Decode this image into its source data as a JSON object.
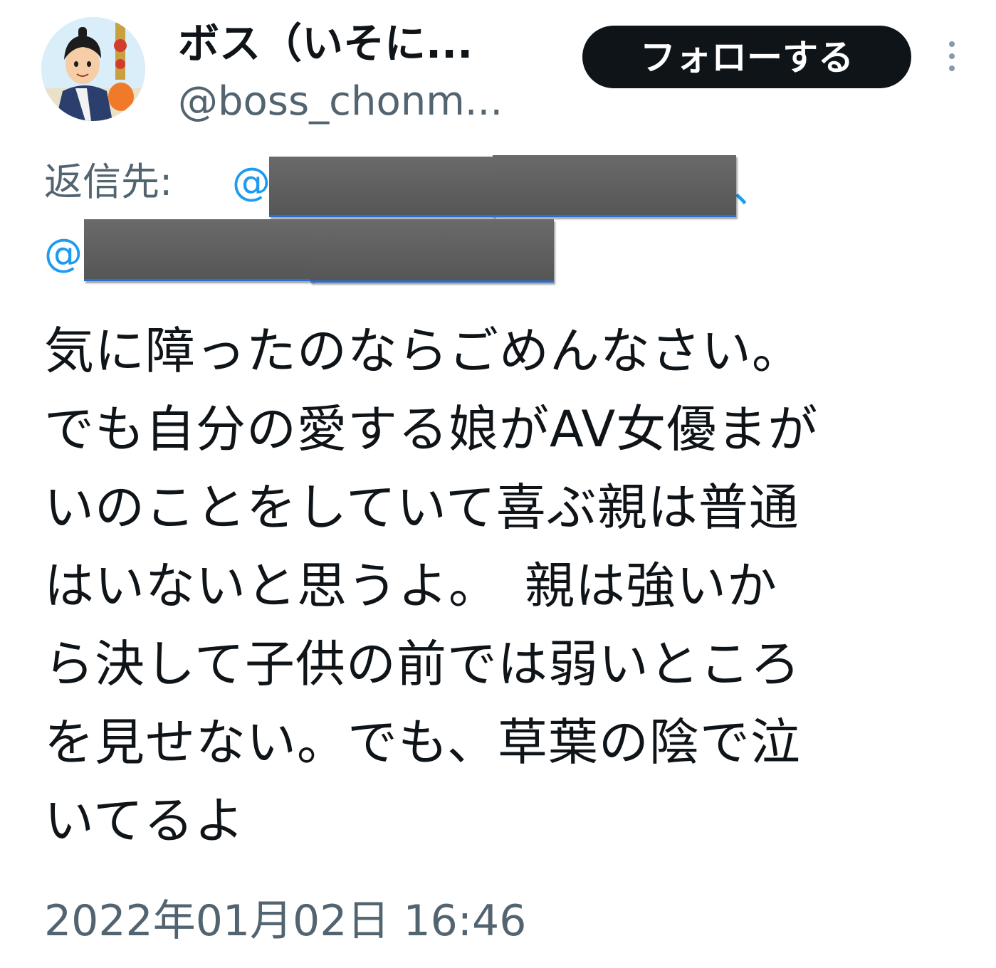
{
  "tweet": {
    "display_name": "ボス（いそに...",
    "handle": "@boss_chonm...",
    "follow_label": "フォローする",
    "reply_label": "返信先:",
    "reply_at_1": "@",
    "reply_at_2": "@",
    "reply_separator": "、",
    "text_lines": [
      "気に障ったのならごめんなさい。",
      "でも自分の愛する娘がAV女優まが",
      "いのことをしていて喜ぶ親は普通",
      "はいないと思うよ。　親は強いか",
      "ら決して子供の前では弱いところ",
      "を見せない。でも、草葉の陰で泣",
      "いてるよ"
    ],
    "timestamp": "2022年01月02日 16:46"
  },
  "icons": {
    "avatar": "avatar-illustration",
    "more": "more-options-vertical-icon"
  },
  "colors": {
    "text_primary": "#0f1419",
    "text_secondary": "#536471",
    "link": "#1d9bf0",
    "follow_button_bg": "#0f1419",
    "redaction": "#5f5f5f"
  }
}
